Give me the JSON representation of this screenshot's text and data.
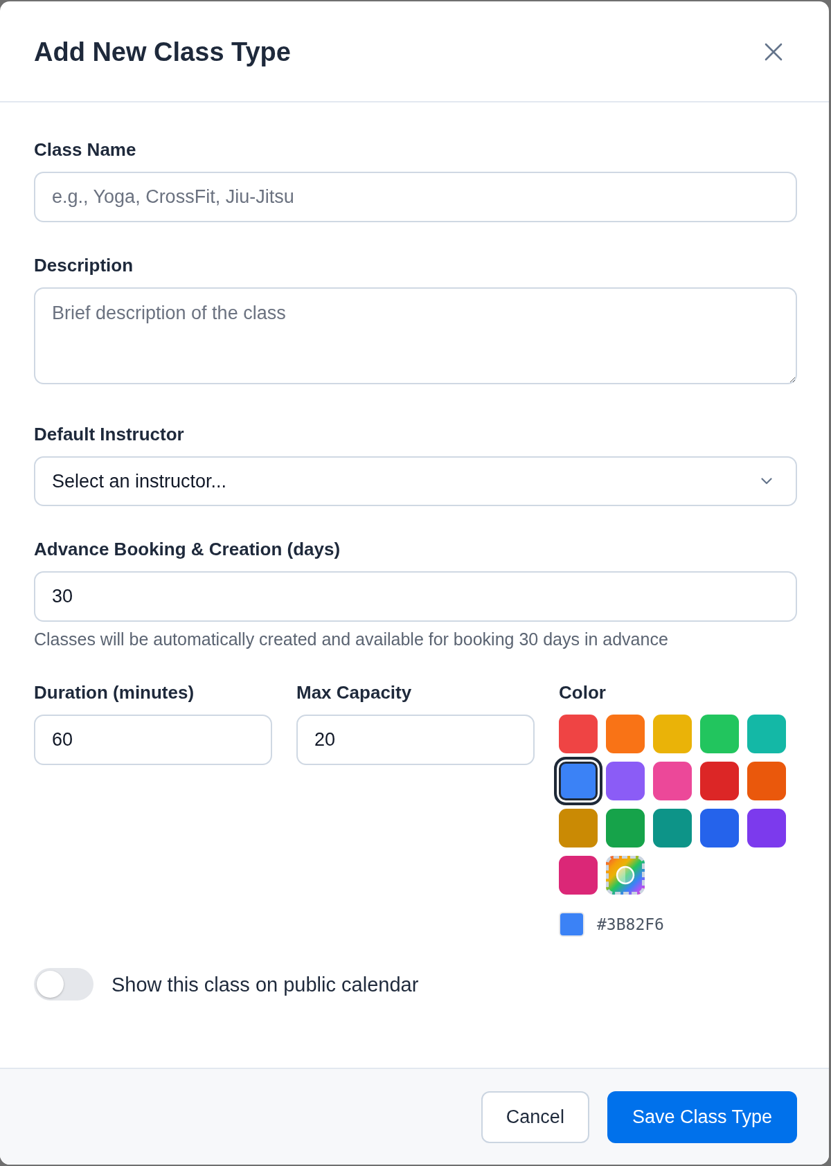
{
  "dialog": {
    "title": "Add New Class Type"
  },
  "fields": [
    {
      "kind": "text",
      "label": "Class Name",
      "placeholder": "e.g., Yoga, CrossFit, Jiu-Jitsu"
    },
    {
      "kind": "textarea",
      "label": "Description",
      "placeholder": "Brief description of the class"
    },
    {
      "kind": "select",
      "label": "Default Instructor",
      "value": "Select an instructor..."
    },
    {
      "kind": "number",
      "label": "Advance Booking & Creation (days)",
      "value": "30",
      "help": "Classes will be automatically created and available for booking 30 days in advance"
    }
  ],
  "columns": [
    {
      "kind": "number",
      "label": "Duration (minutes)",
      "value": "60"
    },
    {
      "kind": "number",
      "label": "Max Capacity",
      "value": "20"
    }
  ],
  "color_picker": {
    "label": "Color",
    "swatches": [
      {
        "kind": "preset",
        "color": "#ef4444",
        "selected": false
      },
      {
        "kind": "preset",
        "color": "#f97316",
        "selected": false
      },
      {
        "kind": "preset",
        "color": "#eab308",
        "selected": false
      },
      {
        "kind": "preset",
        "color": "#22c55e",
        "selected": false
      },
      {
        "kind": "preset",
        "color": "#14b8a6",
        "selected": false
      },
      {
        "kind": "preset",
        "color": "#3b82f6",
        "selected": true
      },
      {
        "kind": "preset",
        "color": "#8b5cf6",
        "selected": false
      },
      {
        "kind": "preset",
        "color": "#ec4899",
        "selected": false
      },
      {
        "kind": "preset",
        "color": "#dc2626",
        "selected": false
      },
      {
        "kind": "preset",
        "color": "#ea580c",
        "selected": false
      },
      {
        "kind": "preset",
        "color": "#ca8a04",
        "selected": false
      },
      {
        "kind": "preset",
        "color": "#16a34a",
        "selected": false
      },
      {
        "kind": "preset",
        "color": "#0d9488",
        "selected": false
      },
      {
        "kind": "preset",
        "color": "#2563eb",
        "selected": false
      },
      {
        "kind": "preset",
        "color": "#7c3aed",
        "selected": false
      },
      {
        "kind": "preset",
        "color": "#db2777",
        "selected": false
      },
      {
        "kind": "custom",
        "selected": false
      }
    ],
    "hex": "#3B82F6"
  },
  "public_toggle": {
    "label": "Show this class on public calendar",
    "on": false
  },
  "buttons": [
    {
      "kind": "secondary",
      "label": "Cancel"
    },
    {
      "kind": "primary",
      "label": "Save Class Type"
    }
  ]
}
